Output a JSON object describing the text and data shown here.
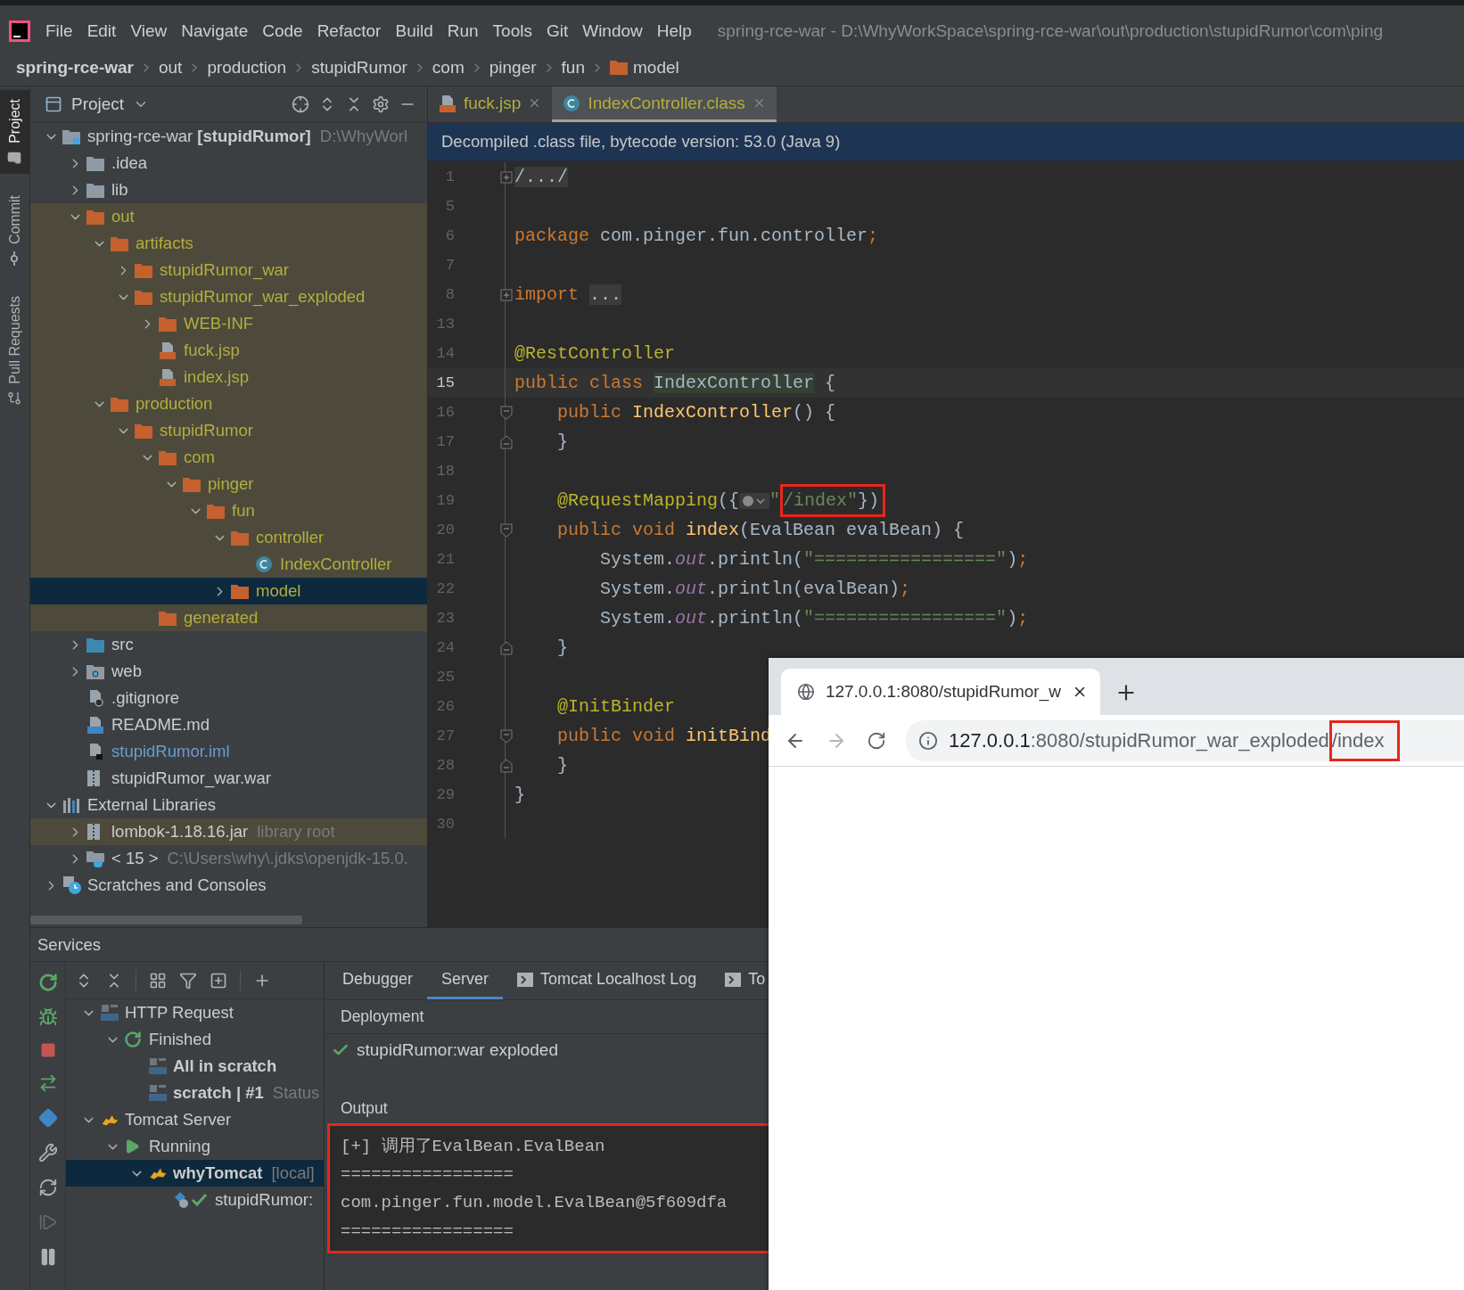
{
  "menu_bar": {
    "items": [
      "File",
      "Edit",
      "View",
      "Navigate",
      "Code",
      "Refactor",
      "Build",
      "Run",
      "Tools",
      "Git",
      "Window",
      "Help"
    ],
    "title": "spring-rce-war - D:\\WhyWorkSpace\\spring-rce-war\\out\\production\\stupidRumor\\com\\ping"
  },
  "breadcrumb": [
    {
      "label": "spring-rce-war",
      "kind": "project"
    },
    {
      "label": "out",
      "kind": "dir"
    },
    {
      "label": "production",
      "kind": "dir"
    },
    {
      "label": "stupidRumor",
      "kind": "dir"
    },
    {
      "label": "com",
      "kind": "dir"
    },
    {
      "label": "pinger",
      "kind": "dir"
    },
    {
      "label": "fun",
      "kind": "dir"
    },
    {
      "label": "model",
      "kind": "folder"
    }
  ],
  "tool_strip": [
    {
      "label": "Project",
      "kind": "project",
      "selected": true
    },
    {
      "label": "Commit",
      "kind": "commit",
      "selected": false
    },
    {
      "label": "Pull Requests",
      "kind": "pull",
      "selected": false
    }
  ],
  "project_panel": {
    "title": "Project",
    "tree": [
      {
        "label": "spring-rce-war **[stupidRumor]**",
        "hint": "D:\\WhyWorl",
        "kind": "module",
        "excluded": false,
        "selected": false,
        "expanded": true,
        "children": [
          {
            "label": ".idea",
            "kind": "folder",
            "excluded": false,
            "selected": false,
            "expanded": false
          },
          {
            "label": "lib",
            "kind": "folder",
            "excluded": false,
            "selected": false,
            "expanded": false
          },
          {
            "label": "out",
            "kind": "folder",
            "excluded": true,
            "selected": false,
            "expanded": true,
            "children": [
              {
                "label": "artifacts",
                "kind": "folder",
                "excluded": true,
                "selected": false,
                "expanded": true,
                "children": [
                  {
                    "label": "stupidRumor_war",
                    "kind": "folder",
                    "excluded": true,
                    "selected": false,
                    "expanded": false
                  },
                  {
                    "label": "stupidRumor_war_exploded",
                    "kind": "folder",
                    "excluded": true,
                    "selected": false,
                    "expanded": true,
                    "children": [
                      {
                        "label": "WEB-INF",
                        "kind": "folder",
                        "excluded": true,
                        "selected": false,
                        "expanded": false
                      },
                      {
                        "label": "fuck.jsp",
                        "kind": "jsp",
                        "excluded": true,
                        "selected": false
                      },
                      {
                        "label": "index.jsp",
                        "kind": "jsp",
                        "excluded": true,
                        "selected": false
                      }
                    ]
                  }
                ]
              },
              {
                "label": "production",
                "kind": "folder",
                "excluded": true,
                "selected": false,
                "expanded": true,
                "children": [
                  {
                    "label": "stupidRumor",
                    "kind": "folder",
                    "excluded": true,
                    "selected": false,
                    "expanded": true,
                    "children": [
                      {
                        "label": "com",
                        "kind": "folder",
                        "excluded": true,
                        "selected": false,
                        "expanded": true,
                        "children": [
                          {
                            "label": "pinger",
                            "kind": "folder",
                            "excluded": true,
                            "selected": false,
                            "expanded": true,
                            "children": [
                              {
                                "label": "fun",
                                "kind": "folder",
                                "excluded": true,
                                "selected": false,
                                "expanded": true,
                                "children": [
                                  {
                                    "label": "controller",
                                    "kind": "folder",
                                    "excluded": true,
                                    "selected": false,
                                    "expanded": true,
                                    "children": [
                                      {
                                        "label": "IndexController",
                                        "kind": "class",
                                        "excluded": true,
                                        "selected": false
                                      }
                                    ]
                                  },
                                  {
                                    "label": "model",
                                    "kind": "folder",
                                    "excluded": true,
                                    "selected": true,
                                    "expanded": false
                                  }
                                ]
                              }
                            ]
                          }
                        ]
                      },
                      {
                        "label": "generated",
                        "kind": "folder",
                        "excluded": true,
                        "selected": false
                      }
                    ]
                  }
                ]
              }
            ]
          },
          {
            "label": "src",
            "kind": "folder-source",
            "excluded": false,
            "selected": false,
            "expanded": false
          },
          {
            "label": "web",
            "kind": "folder-web",
            "excluded": false,
            "selected": false,
            "expanded": false
          },
          {
            "label": ".gitignore",
            "kind": "ignore",
            "excluded": false,
            "selected": false
          },
          {
            "label": "README.md",
            "kind": "markdown",
            "excluded": false,
            "selected": false
          },
          {
            "label": "stupidRumor.iml",
            "kind": "iml",
            "excluded": false,
            "modified": true,
            "selected": false
          },
          {
            "label": "stupidRumor_war.war",
            "kind": "archive",
            "excluded": false,
            "selected": false
          }
        ]
      },
      {
        "label": "External Libraries",
        "kind": "libraries",
        "excluded": false,
        "selected": false,
        "expanded": true,
        "children": [
          {
            "label": "lombok-1.18.16.jar",
            "hint": "library root",
            "kind": "archive",
            "excluded": false,
            "library": true,
            "selected": false,
            "expanded": false
          },
          {
            "label": "< 15 >",
            "hint": "C:\\Users\\why\\.jdks\\openjdk-15.0.",
            "kind": "jdk",
            "excluded": false,
            "selected": false,
            "expanded": false
          }
        ]
      },
      {
        "label": "Scratches and Consoles",
        "kind": "scratches",
        "excluded": false,
        "selected": false,
        "expanded": false
      }
    ]
  },
  "editor": {
    "tabs": [
      {
        "label": "fuck.jsp",
        "kind": "jsp",
        "excluded": true,
        "selected": false
      },
      {
        "label": "IndexController.class",
        "kind": "class",
        "excluded": true,
        "selected": true
      }
    ],
    "banner": "Decompiled .class file, bytecode version: 53.0 (Java 9)",
    "lines": [
      {
        "number": "1",
        "kind": "fold-expand",
        "current": false,
        "tokens": [
          {
            "text": "/.../",
            "kind": "folded"
          }
        ]
      },
      {
        "number": "5",
        "kind": "plain",
        "current": false
      },
      {
        "number": "6",
        "kind": "plain",
        "current": false,
        "tokens": [
          {
            "text": "package",
            "kind": "keyword"
          },
          {
            "text": " com.pinger.fun.controller",
            "kind": "plain"
          },
          {
            "text": ";",
            "kind": "keyword"
          }
        ]
      },
      {
        "number": "7",
        "kind": "plain",
        "current": false
      },
      {
        "number": "8",
        "kind": "fold-expand",
        "current": false,
        "tokens": [
          {
            "text": "import ",
            "kind": "keyword"
          },
          {
            "text": "...",
            "kind": "folded"
          }
        ]
      },
      {
        "number": "13",
        "kind": "plain",
        "current": false
      },
      {
        "number": "14",
        "kind": "plain",
        "current": false,
        "tokens": [
          {
            "text": "@RestController",
            "kind": "annotation"
          }
        ]
      },
      {
        "number": "15",
        "kind": "plain",
        "current": true,
        "tokens": [
          {
            "text": "public class ",
            "kind": "keyword"
          },
          {
            "text": "IndexController",
            "kind": "declaration"
          },
          {
            "text": " {",
            "kind": "plain"
          }
        ]
      },
      {
        "number": "16",
        "kind": "fold-start",
        "current": false,
        "tokens": [
          {
            "text": "    public ",
            "kind": "keyword"
          },
          {
            "text": "IndexController",
            "kind": "method"
          },
          {
            "text": "() {",
            "kind": "plain"
          }
        ]
      },
      {
        "number": "17",
        "kind": "fold-end",
        "current": false,
        "tokens": [
          {
            "text": "    }",
            "kind": "plain"
          }
        ]
      },
      {
        "number": "18",
        "kind": "plain",
        "current": false
      },
      {
        "number": "19",
        "kind": "plain",
        "current": false,
        "tokens": [
          {
            "text": "    @RequestMapping",
            "kind": "annotation"
          },
          {
            "text": "({",
            "kind": "plain"
          },
          {
            "kind": "inlay"
          },
          {
            "text": "\"",
            "kind": "string"
          },
          {
            "text": "/index\"",
            "kind": "string",
            "boxed": true
          },
          {
            "text": "})",
            "kind": "plain",
            "boxed": true
          }
        ]
      },
      {
        "number": "20",
        "kind": "fold-start",
        "current": false,
        "tokens": [
          {
            "text": "    public void ",
            "kind": "keyword"
          },
          {
            "text": "index",
            "kind": "method"
          },
          {
            "text": "(EvalBean evalBean) {",
            "kind": "plain"
          }
        ]
      },
      {
        "number": "21",
        "kind": "plain",
        "current": false,
        "tokens": [
          {
            "text": "        System.",
            "kind": "plain"
          },
          {
            "text": "out",
            "kind": "static"
          },
          {
            "text": ".println(",
            "kind": "plain"
          },
          {
            "text": "\"=================\"",
            "kind": "string"
          },
          {
            "text": ")",
            "kind": "plain"
          },
          {
            "text": ";",
            "kind": "keyword"
          }
        ]
      },
      {
        "number": "22",
        "kind": "plain",
        "current": false,
        "tokens": [
          {
            "text": "        System.",
            "kind": "plain"
          },
          {
            "text": "out",
            "kind": "static"
          },
          {
            "text": ".println(evalBean)",
            "kind": "plain"
          },
          {
            "text": ";",
            "kind": "keyword"
          }
        ]
      },
      {
        "number": "23",
        "kind": "plain",
        "current": false,
        "tokens": [
          {
            "text": "        System.",
            "kind": "plain"
          },
          {
            "text": "out",
            "kind": "static"
          },
          {
            "text": ".println(",
            "kind": "plain"
          },
          {
            "text": "\"=================\"",
            "kind": "string"
          },
          {
            "text": ")",
            "kind": "plain"
          },
          {
            "text": ";",
            "kind": "keyword"
          }
        ]
      },
      {
        "number": "24",
        "kind": "fold-end",
        "current": false,
        "tokens": [
          {
            "text": "    }",
            "kind": "plain"
          }
        ]
      },
      {
        "number": "25",
        "kind": "plain",
        "current": false
      },
      {
        "number": "26",
        "kind": "plain",
        "current": false,
        "tokens": [
          {
            "text": "    @InitBinder",
            "kind": "annotation"
          }
        ]
      },
      {
        "number": "27",
        "kind": "fold-start",
        "current": false,
        "tokens": [
          {
            "text": "    public void ",
            "kind": "keyword"
          },
          {
            "text": "initBind",
            "kind": "method"
          }
        ]
      },
      {
        "number": "28",
        "kind": "fold-end",
        "current": false,
        "tokens": [
          {
            "text": "    }",
            "kind": "plain"
          }
        ]
      },
      {
        "number": "29",
        "kind": "plain",
        "current": false,
        "tokens": [
          {
            "text": "}",
            "kind": "plain"
          }
        ]
      },
      {
        "number": "30",
        "kind": "plain",
        "current": false
      }
    ]
  },
  "services": {
    "title": "Services",
    "tree": [
      {
        "label": "HTTP Request",
        "kind": "api",
        "emphasis": false,
        "selected": false,
        "expanded": true,
        "children": [
          {
            "label": "Finished",
            "kind": "rerun",
            "emphasis": false,
            "selected": false,
            "expanded": true,
            "children": [
              {
                "label": "All in scratch",
                "kind": "api",
                "emphasis": true,
                "selected": false
              },
              {
                "label": "scratch  |  #1",
                "hint": "Status",
                "kind": "api",
                "emphasis": true,
                "selected": false
              }
            ]
          }
        ]
      },
      {
        "label": "Tomcat Server",
        "kind": "tomcat",
        "emphasis": false,
        "selected": false,
        "expanded": true,
        "children": [
          {
            "label": "Running",
            "kind": "running",
            "emphasis": false,
            "selected": false,
            "expanded": true,
            "children": [
              {
                "label": "whyTomcat",
                "hint": "[local]",
                "kind": "tomcat",
                "emphasis": true,
                "selected": true,
                "expanded": true,
                "children": [
                  {
                    "label": "stupidRumor:",
                    "kind": "deployed",
                    "emphasis": false,
                    "selected": false
                  }
                ]
              }
            ]
          }
        ]
      }
    ],
    "tabs": [
      {
        "label": "Debugger",
        "kind": "plain",
        "selected": false
      },
      {
        "label": "Server",
        "kind": "plain",
        "selected": true
      },
      {
        "label": "Tomcat Localhost Log",
        "kind": "console",
        "selected": false
      },
      {
        "label": "To",
        "kind": "console",
        "selected": false
      }
    ],
    "deployment_header": "Deployment",
    "deployments": [
      {
        "label": "stupidRumor:war exploded"
      }
    ],
    "output_label": "Output",
    "output": {
      "boxed": true,
      "lines": [
        "[+] 调用了EvalBean.EvalBean",
        "=================",
        "com.pinger.fun.model.EvalBean@5f609dfa",
        "================="
      ]
    }
  },
  "browser": {
    "tab_title": "127.0.0.1:8080/stupidRumor_w",
    "nav": [
      {
        "kind": "back",
        "disabled": false
      },
      {
        "kind": "forward",
        "disabled": true
      },
      {
        "kind": "reload",
        "disabled": false
      }
    ],
    "url": [
      {
        "text": "127.0.0.1",
        "emphasis": true
      },
      {
        "text": ":8080/stupidRumor_war_exploded",
        "emphasis": false
      },
      {
        "text": "/index",
        "emphasis": false,
        "boxed": true
      }
    ]
  }
}
